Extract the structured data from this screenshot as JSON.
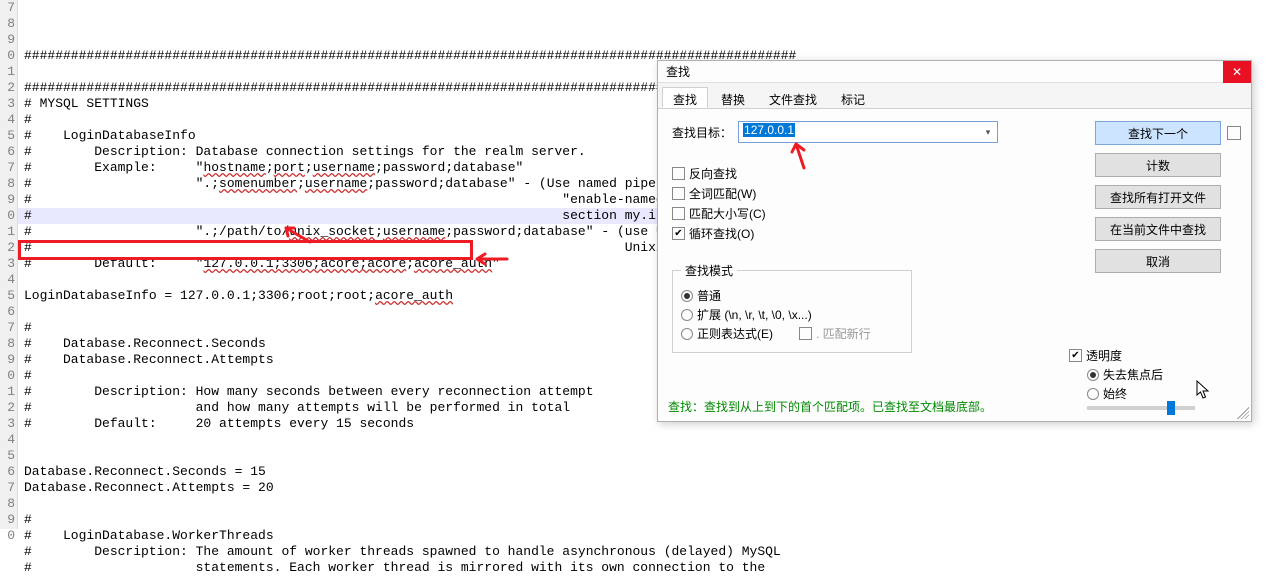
{
  "gutter": [
    "7",
    "8",
    "9",
    "0",
    "1",
    "2",
    "3",
    "4",
    "5",
    "6",
    "7",
    "8",
    "9",
    "0",
    "1",
    "2",
    "3",
    "4",
    "5",
    "6",
    "7",
    "8",
    "9",
    "0",
    "1",
    "2",
    "3",
    "4",
    "5",
    "6",
    "7",
    "8",
    "9",
    "0"
  ],
  "code_lines": [
    "###################################################################################################",
    "",
    "###################################################################################################",
    "# MYSQL SETTINGS",
    "#",
    "#    LoginDatabaseInfo",
    "#        Description: Database connection settings for the realm server.",
    "#        Example:     \"hostname;port;username;password;database\"",
    "#                     \".;somenumber;username;password;database\" - (Use named pipes on Windows",
    "#                                                                    \"enable-named-pipe\" to [mysqld]",
    "#                                                                    section my.ini)",
    "#                     \".;/path/to/unix_socket;username;password;database\" - (use Unix sockets on",
    "#                                                                            Unix/Linux)",
    "#        Default:     \"127.0.0.1;3306;acore;acore;acore_auth\"",
    "",
    "LoginDatabaseInfo = 127.0.0.1;3306;root;root;acore_auth",
    "",
    "#",
    "#    Database.Reconnect.Seconds",
    "#    Database.Reconnect.Attempts",
    "#",
    "#        Description: How many seconds between every reconnection attempt",
    "#                     and how many attempts will be performed in total",
    "#        Default:     20 attempts every 15 seconds",
    "",
    "",
    "Database.Reconnect.Seconds = 15",
    "Database.Reconnect.Attempts = 20",
    "",
    "#",
    "#    LoginDatabase.WorkerThreads",
    "#        Description: The amount of worker threads spawned to handle asynchronous (delayed) MySQL",
    "#                     statements. Each worker thread is mirrored with its own connection to the"
  ],
  "highlight_line_index": 13,
  "dialog": {
    "title": "查找",
    "tabs": [
      "查找",
      "替换",
      "文件查找",
      "标记"
    ],
    "search_label": "查找目标：",
    "search_value": "127.0.0.1",
    "buttons": {
      "find_next": "查找下一个",
      "count": "计数",
      "find_all_open": "查找所有打开文件",
      "find_in_current": "在当前文件中查找",
      "cancel": "取消"
    },
    "checks": {
      "backward": "反向查找",
      "whole_word": "全词匹配(W)",
      "match_case": "匹配大小写(C)",
      "wrap": "循环查找(O)"
    },
    "mode_legend": "查找模式",
    "modes": {
      "normal": "普通",
      "extended": "扩展 (\\n, \\r, \\t, \\0, \\x...)",
      "regex": "正则表达式(E)",
      "match_newline": ". 匹配新行"
    },
    "transparency": {
      "label": "透明度",
      "on_lose_focus": "失去焦点后",
      "always": "始终"
    },
    "status": "查找：查找到从上到下的首个匹配项。已查找至文档最底部。"
  }
}
